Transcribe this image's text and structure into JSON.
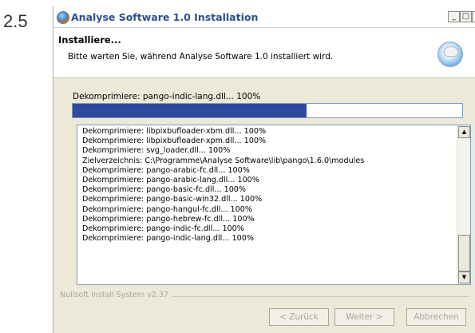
{
  "page": {
    "step_number": "2.5"
  },
  "window": {
    "title": "Analyse Software 1.0 Installation",
    "controls": {
      "minimize": "_",
      "maximize": "□",
      "close": "×"
    }
  },
  "header": {
    "title": "Installiere...",
    "subtitle": "Bitte warten Sie, während Analyse Software 1.0 installiert wird."
  },
  "status": {
    "text": "Dekomprimiere: pango-indic-lang.dll... 100%",
    "progress_fraction": 0.6
  },
  "log": {
    "lines": [
      "Dekomprimiere: libpixbufloader-xbm.dll... 100%",
      "Dekomprimiere: libpixbufloader-xpm.dll... 100%",
      "Dekomprimiere: svg_loader.dll... 100%",
      "Zielverzeichnis: C:\\Programme\\Analyse Software\\lib\\pango\\1.6.0\\modules",
      "Dekomprimiere: pango-arabic-fc.dll... 100%",
      "Dekomprimiere: pango-arabic-lang.dll... 100%",
      "Dekomprimiere: pango-basic-fc.dll... 100%",
      "Dekomprimiere: pango-basic-win32.dll... 100%",
      "Dekomprimiere: pango-hangul-fc.dll... 100%",
      "Dekomprimiere: pango-hebrew-fc.dll... 100%",
      "Dekomprimiere: pango-indic-fc.dll... 100%",
      "Dekomprimiere: pango-indic-lang.dll... 100%"
    ],
    "scroll_up": "▲",
    "scroll_down": "▼"
  },
  "branding": "Nullsoft Install System v2.37",
  "buttons": {
    "back": "< Zurück",
    "next": "Weiter >",
    "cancel": "Abbrechen"
  }
}
